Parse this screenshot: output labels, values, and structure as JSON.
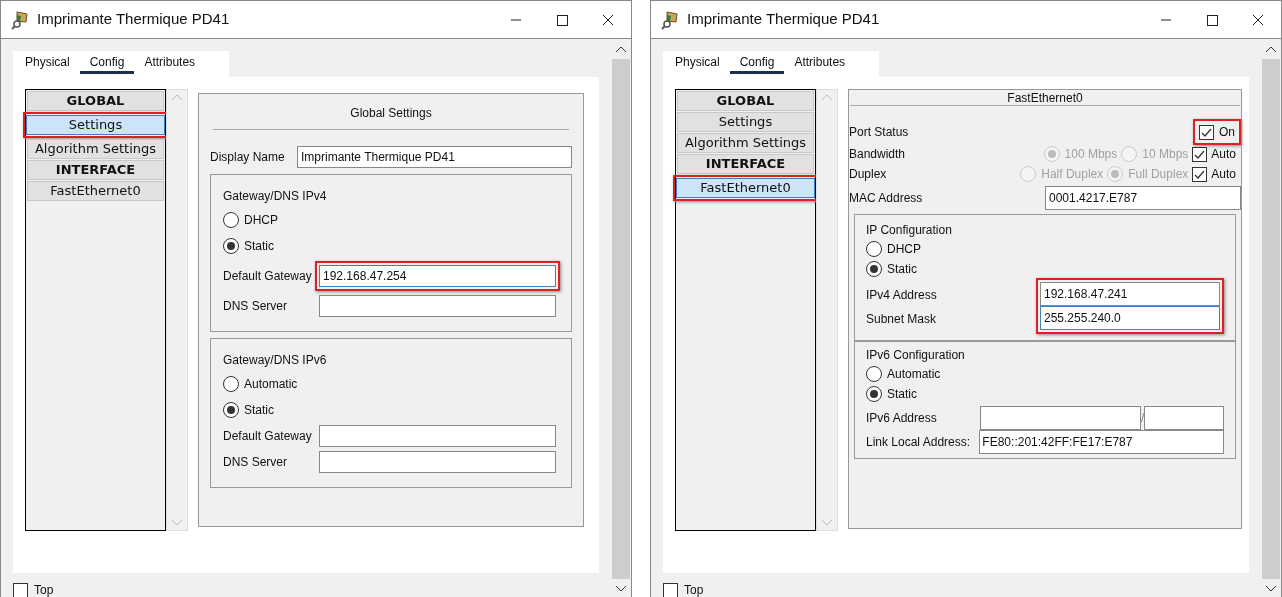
{
  "windows": [
    {
      "kind": "global",
      "title": "Imprimante Thermique PD41",
      "tabs": [
        {
          "label": "Physical",
          "selected": false
        },
        {
          "label": "Config",
          "selected": true
        },
        {
          "label": "Attributes",
          "selected": false
        }
      ],
      "sidebar": [
        {
          "kind": "header",
          "label": "GLOBAL",
          "selected": false,
          "highlighted": false
        },
        {
          "kind": "item",
          "label": "Settings",
          "selected": true,
          "highlighted": true
        },
        {
          "kind": "item",
          "label": "Algorithm Settings",
          "selected": false,
          "highlighted": false
        },
        {
          "kind": "header",
          "label": "INTERFACE",
          "selected": false,
          "highlighted": false
        },
        {
          "kind": "item",
          "label": "FastEthernet0",
          "selected": false,
          "highlighted": false
        }
      ],
      "panel": {
        "title": "Global Settings",
        "display_name": {
          "label": "Display Name",
          "value": "Imprimante Thermique PD41"
        },
        "groups": [
          {
            "title": "Gateway/DNS IPv4",
            "options": [
              {
                "label": "DHCP",
                "selected": false
              },
              {
                "label": "Static",
                "selected": true
              }
            ],
            "fields": [
              {
                "label": "Default Gateway",
                "value": "192.168.47.254",
                "highlighted": true,
                "focused": true
              },
              {
                "label": "DNS Server",
                "highlighted": false,
                "focused": false
              }
            ]
          },
          {
            "title": "Gateway/DNS IPv6",
            "options": [
              {
                "label": "Automatic",
                "selected": false
              },
              {
                "label": "Static",
                "selected": true
              }
            ],
            "fields": [
              {
                "label": "Default Gateway",
                "highlighted": false,
                "focused": false
              },
              {
                "label": "DNS Server",
                "highlighted": false,
                "focused": false
              }
            ]
          }
        ]
      },
      "top_checkbox": {
        "label": "Top",
        "checked": false
      }
    },
    {
      "kind": "interface",
      "title": "Imprimante Thermique PD41",
      "tabs": [
        {
          "label": "Physical",
          "selected": false
        },
        {
          "label": "Config",
          "selected": true
        },
        {
          "label": "Attributes",
          "selected": false
        }
      ],
      "sidebar": [
        {
          "kind": "header",
          "label": "GLOBAL",
          "selected": false,
          "highlighted": false
        },
        {
          "kind": "item",
          "label": "Settings",
          "selected": false,
          "highlighted": false
        },
        {
          "kind": "item",
          "label": "Algorithm Settings",
          "selected": false,
          "highlighted": false
        },
        {
          "kind": "header",
          "label": "INTERFACE",
          "selected": false,
          "highlighted": false
        },
        {
          "kind": "item",
          "label": "FastEthernet0",
          "selected": true,
          "highlighted": true
        }
      ],
      "panel": {
        "title": "FastEthernet0",
        "port_status": {
          "label": "Port Status",
          "checkbox_label": "On",
          "checked": true,
          "highlighted": true
        },
        "rows": [
          {
            "label": "Bandwidth",
            "options": [
              {
                "label": "100 Mbps",
                "selected": true
              },
              {
                "label": "10 Mbps",
                "selected": false
              }
            ],
            "auto": {
              "label": "Auto",
              "checked": true
            }
          },
          {
            "label": "Duplex",
            "options": [
              {
                "label": "Half Duplex",
                "selected": false
              },
              {
                "label": "Full Duplex",
                "selected": true
              }
            ],
            "auto": {
              "label": "Auto",
              "checked": true
            }
          }
        ],
        "mac": {
          "label": "MAC Address",
          "value": "0001.4217.E787"
        },
        "ipv4": {
          "title": "IP Configuration",
          "options": [
            {
              "label": "DHCP",
              "selected": false
            },
            {
              "label": "Static",
              "selected": true
            }
          ],
          "highlighted": true,
          "fields": [
            {
              "label": "IPv4 Address",
              "value": "192.168.47.241",
              "focused": false
            },
            {
              "label": "Subnet Mask",
              "value": "255.255.240.0",
              "focused": true
            }
          ]
        },
        "ipv6": {
          "title": "IPv6 Configuration",
          "options": [
            {
              "label": "Automatic",
              "selected": false
            },
            {
              "label": "Static",
              "selected": true
            }
          ],
          "address_label": "IPv6 Address",
          "separator": "/",
          "link_local": {
            "label": "Link Local Address:",
            "value": "FE80::201:42FF:FE17:E787"
          }
        }
      },
      "top_checkbox": {
        "label": "Top",
        "checked": false
      }
    }
  ]
}
